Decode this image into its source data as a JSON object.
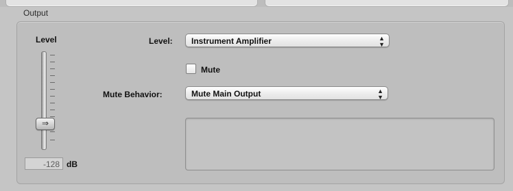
{
  "group": {
    "title": "Output"
  },
  "fader": {
    "label": "Level",
    "value": "-128",
    "unit": "dB",
    "thumb_glyph": "⇒"
  },
  "level_row": {
    "label": "Level:",
    "selected": "Instrument Amplifier"
  },
  "mute_row": {
    "label": "Mute",
    "checked": false
  },
  "mute_behavior_row": {
    "label": "Mute Behavior:",
    "selected": "Mute Main Output"
  },
  "icons": {
    "popup_arrows": "up-down-arrows-icon",
    "fader_thumb": "fader-thumb-arrow-icon"
  }
}
